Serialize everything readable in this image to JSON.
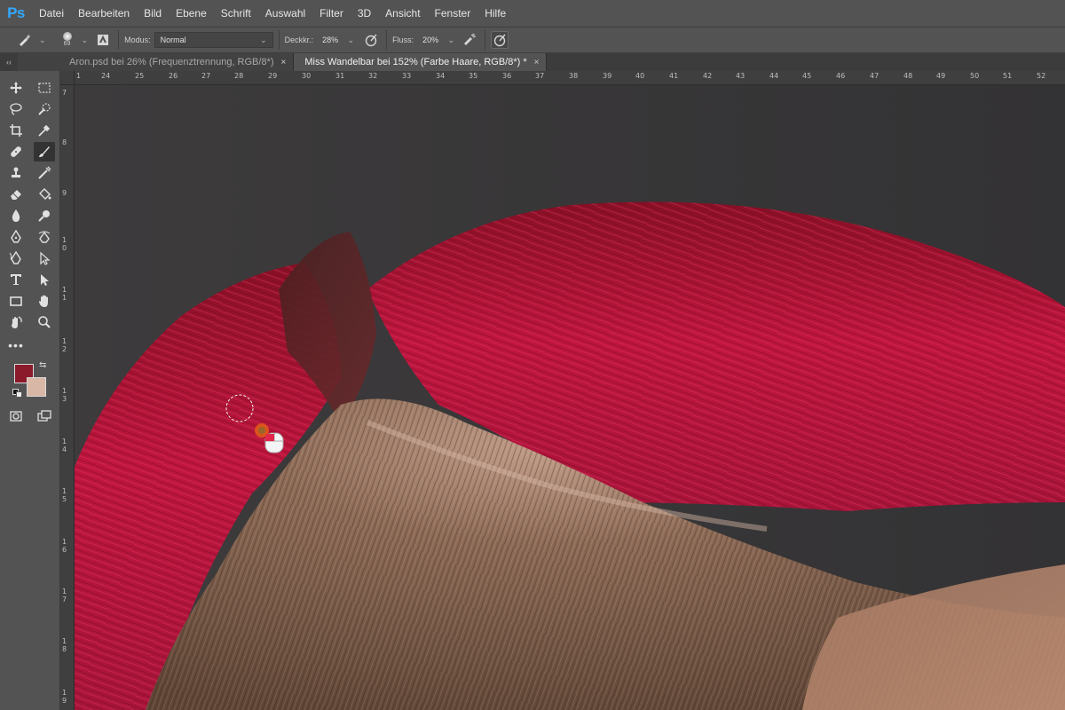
{
  "app": {
    "logo": "Ps"
  },
  "menu": [
    "Datei",
    "Bearbeiten",
    "Bild",
    "Ebene",
    "Schrift",
    "Auswahl",
    "Filter",
    "3D",
    "Ansicht",
    "Fenster",
    "Hilfe"
  ],
  "options": {
    "brush_size": "69",
    "mode_label": "Modus:",
    "mode_value": "Normal",
    "opacity_label": "Deckkr.:",
    "opacity_value": "28%",
    "flow_label": "Fluss:",
    "flow_value": "20%"
  },
  "tabs": [
    {
      "label": "Aron.psd bei 26% (Frequenztrennung, RGB/8*)",
      "close": "×",
      "active": false
    },
    {
      "label": "Miss Wandelbar bei 152% (Farbe Haare, RGB/8*) *",
      "close": "×",
      "active": true
    }
  ],
  "panel_collapse": "‹‹",
  "rulers": {
    "top": [
      "1",
      "24",
      "25",
      "26",
      "27",
      "28",
      "29",
      "30",
      "31",
      "32",
      "33",
      "34",
      "35",
      "36",
      "37",
      "38",
      "39",
      "40",
      "41",
      "42",
      "43",
      "44",
      "45",
      "46",
      "47",
      "48",
      "49",
      "50",
      "51",
      "52"
    ],
    "left": [
      "7",
      "8",
      "9",
      "10",
      "11",
      "12",
      "13",
      "14",
      "15",
      "16",
      "17",
      "18",
      "19"
    ]
  },
  "colors": {
    "foreground": "#8b1a2a",
    "background": "#d8b7a6",
    "accent": "#31a8ff"
  },
  "tools": [
    "move-tool",
    "marquee-tool",
    "lasso-tool",
    "quick-selection-tool",
    "crop-tool",
    "eyedropper-tool",
    "healing-brush-tool",
    "brush-tool",
    "clone-stamp-tool",
    "history-brush-tool",
    "eraser-tool",
    "paint-bucket-tool",
    "blur-tool",
    "dodge-tool",
    "pen-tool",
    "freeform-pen-tool",
    "curvature-pen-tool",
    "path-selection-tool",
    "type-tool",
    "direct-selection-tool",
    "rectangle-tool",
    "hand-tool",
    "rotate-view-tool",
    "zoom-tool",
    "more-tools"
  ]
}
